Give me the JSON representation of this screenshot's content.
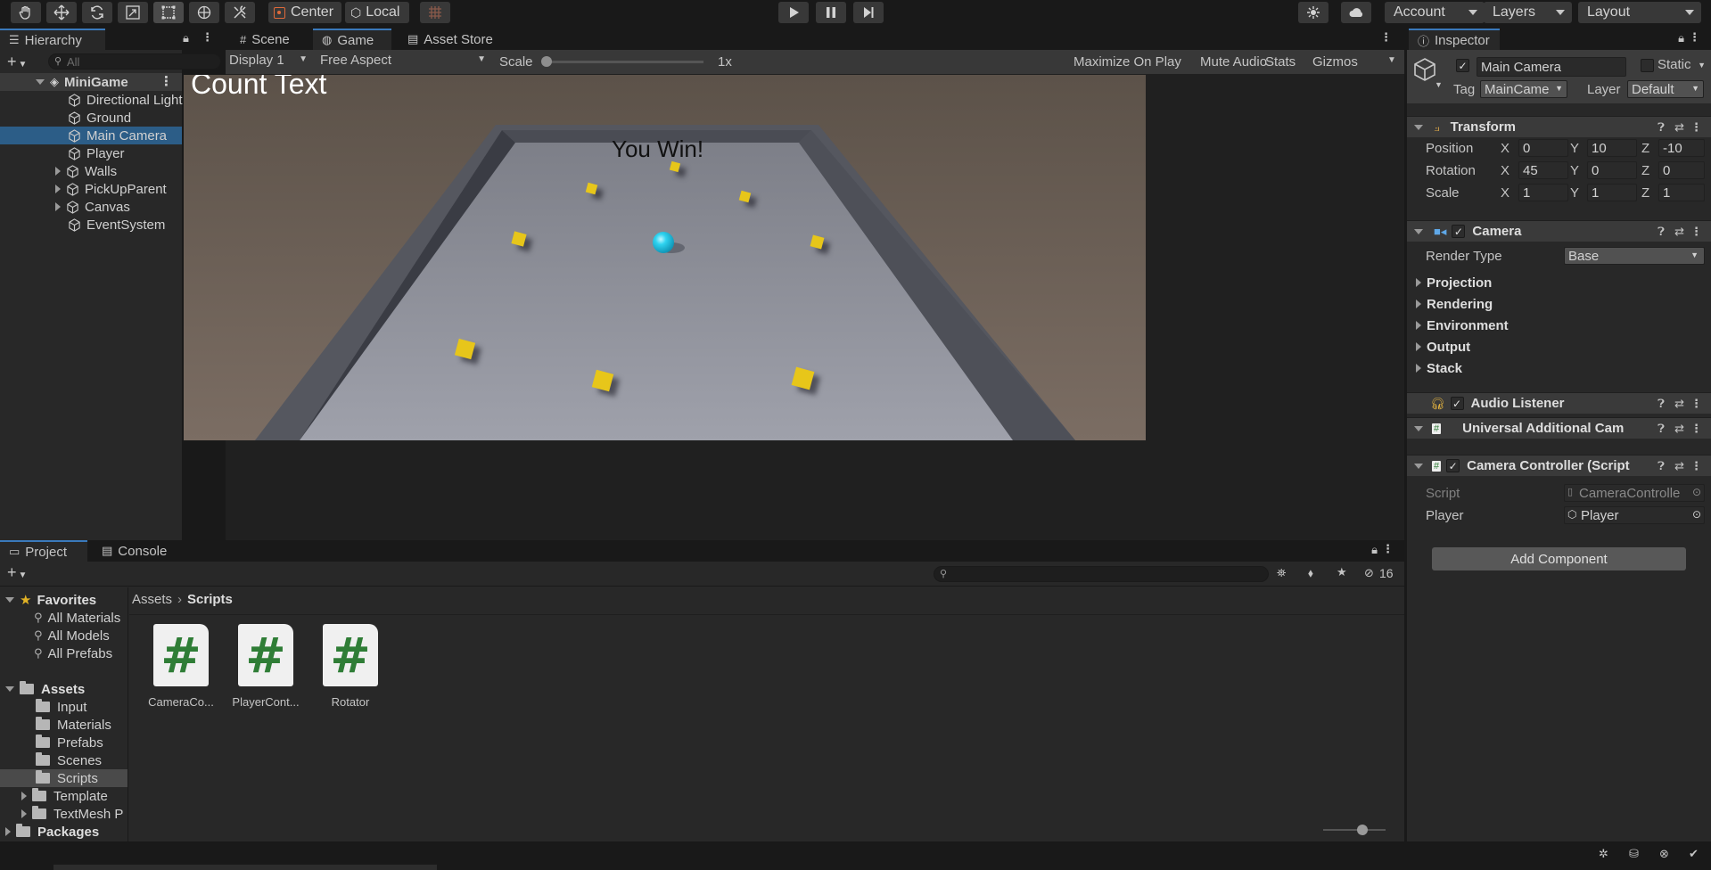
{
  "toolbar": {
    "pivot_label": "Center",
    "space_label": "Local",
    "account_label": "Account",
    "layers_label": "Layers",
    "layout_label": "Layout"
  },
  "hierarchy": {
    "tab_label": "Hierarchy",
    "search_placeholder": "All",
    "scene_name": "MiniGame",
    "items": [
      {
        "label": "Directional Light"
      },
      {
        "label": "Ground"
      },
      {
        "label": "Main Camera",
        "selected": true
      },
      {
        "label": "Player"
      },
      {
        "label": "Walls",
        "expandable": true
      },
      {
        "label": "PickUpParent",
        "expandable": true
      },
      {
        "label": "Canvas",
        "expandable": true
      },
      {
        "label": "EventSystem"
      }
    ]
  },
  "center_tabs": {
    "scene": "Scene",
    "game": "Game",
    "asset_store": "Asset Store"
  },
  "game_toolbar": {
    "display": "Display 1",
    "aspect": "Free Aspect",
    "scale_label": "Scale",
    "scale_value": "1x",
    "maximize": "Maximize On Play",
    "mute": "Mute Audio",
    "stats": "Stats",
    "gizmos": "Gizmos"
  },
  "game_view": {
    "count_text": "Count Text",
    "win_text": "You Win!"
  },
  "inspector": {
    "tab_label": "Inspector",
    "object_name": "Main Camera",
    "static_label": "Static",
    "tag_label": "Tag",
    "tag_value": "MainCame",
    "layer_label": "Layer",
    "layer_value": "Default",
    "transform": {
      "title": "Transform",
      "position_label": "Position",
      "rotation_label": "Rotation",
      "scale_label": "Scale",
      "axis_x": "X",
      "axis_y": "Y",
      "axis_z": "Z",
      "position": {
        "x": "0",
        "y": "10",
        "z": "-10"
      },
      "rotation": {
        "x": "45",
        "y": "0",
        "z": "0"
      },
      "scale": {
        "x": "1",
        "y": "1",
        "z": "1"
      }
    },
    "camera": {
      "title": "Camera",
      "render_type_label": "Render Type",
      "render_type_value": "Base",
      "sections": [
        "Projection",
        "Rendering",
        "Environment",
        "Output",
        "Stack"
      ]
    },
    "audio_listener": "Audio Listener",
    "universal_additional": "Universal Additional Cam",
    "camera_controller": {
      "title": "Camera Controller (Script",
      "script_label": "Script",
      "script_value": "CameraControlle",
      "player_label": "Player",
      "player_value": "Player"
    },
    "add_component": "Add Component"
  },
  "project": {
    "tab_project": "Project",
    "tab_console": "Console",
    "hidden_count": "16",
    "favorites_label": "Favorites",
    "favorites": [
      "All Materials",
      "All Models",
      "All Prefabs"
    ],
    "assets_label": "Assets",
    "asset_folders": [
      {
        "label": "Input"
      },
      {
        "label": "Materials"
      },
      {
        "label": "Prefabs"
      },
      {
        "label": "Scenes"
      },
      {
        "label": "Scripts",
        "selected": true
      },
      {
        "label": "Template",
        "expandable": true
      },
      {
        "label": "TextMesh P",
        "expandable": true
      }
    ],
    "packages_label": "Packages",
    "breadcrumb": [
      "Assets",
      "Scripts"
    ],
    "files": [
      "CameraCo...",
      "PlayerCont...",
      "Rotator"
    ]
  },
  "colors": {
    "accent": "#3a79bb",
    "selection": "#2c5d87",
    "pickup": "#e7c61a",
    "player": "#2fd3f0",
    "script_icon_green": "#2f7d36"
  }
}
